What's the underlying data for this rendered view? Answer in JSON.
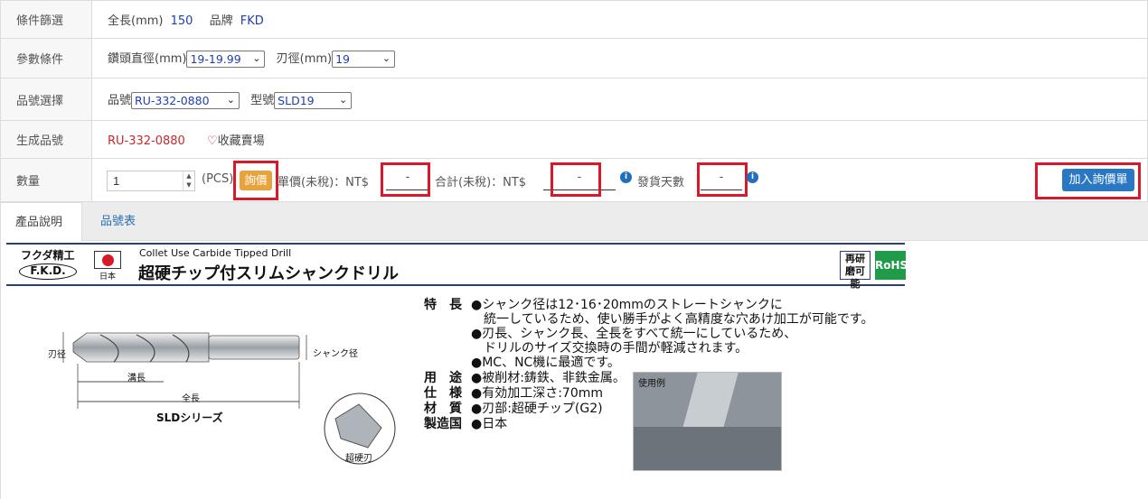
{
  "filters": {
    "condition": {
      "label": "條件篩選",
      "length_label": "全長(mm)",
      "length_value": "150",
      "brand_label": "品牌",
      "brand_value": "FKD"
    },
    "params": {
      "label": "參數條件",
      "drill_dia_label": "鑽頭直徑(mm)",
      "drill_dia_value": "19-19.99",
      "blade_dia_label": "刃徑(mm)",
      "blade_dia_value": "19"
    },
    "model": {
      "label": "品號選擇",
      "part_label": "品號",
      "part_value": "RU-332-0880",
      "type_label": "型號",
      "type_value": "SLD19"
    },
    "generated": {
      "label": "生成品號",
      "value": "RU-332-0880",
      "favorite": "收藏賣場"
    },
    "quantity": {
      "label": "數量",
      "value": "1",
      "unit": "(PCS)",
      "inquire_btn": "詢價",
      "unit_price_label": "單價(未稅)：NT$",
      "unit_price": "-",
      "total_label": "合計(未稅)：NT$",
      "total": "-",
      "ship_days_label": "發貨天數",
      "ship_days": "-",
      "add_btn": "加入詢價單"
    }
  },
  "tabs": [
    "產品說明",
    "品號表"
  ],
  "product_image": {
    "brand_jp": "フクダ精工",
    "brand_logo": "F.K.D.",
    "country": "日本",
    "subtitle_en": "Collet Use Carbide Tipped Drill",
    "title_jp": "超硬チップ付スリムシャンクドリル",
    "badge_regrind": "再研磨可能",
    "badge_rohs": "RoHS",
    "diagram": {
      "blade_dia": "刃径",
      "shank_dia": "シャンク径",
      "groove_len": "溝長",
      "total_len": "全長",
      "series": "SLDシリーズ",
      "carbide": "超硬刃"
    },
    "features": [
      {
        "key": "特　長",
        "text": "●シャンク径は12･16･20mmのストレートシャンクに"
      },
      {
        "key": "",
        "text": "　統一しているため、使い勝手がよく高精度な穴あけ加工が可能です。"
      },
      {
        "key": "",
        "text": "●刃長、シャンク長、全長をすべて統一にしているため、"
      },
      {
        "key": "",
        "text": "　ドリルのサイズ交換時の手間が軽減されます。"
      },
      {
        "key": "",
        "text": "●MC、NC機に最適です。"
      },
      {
        "key": "用　途",
        "text": "●被削材:鋳鉄、非鉄金属。"
      },
      {
        "key": "仕　様",
        "text": "●有効加工深さ:70mm"
      },
      {
        "key": "材　質",
        "text": "●刃部:超硬チップ(G2)"
      },
      {
        "key": "製造国",
        "text": "●日本"
      }
    ],
    "photo_label": "使用例"
  }
}
